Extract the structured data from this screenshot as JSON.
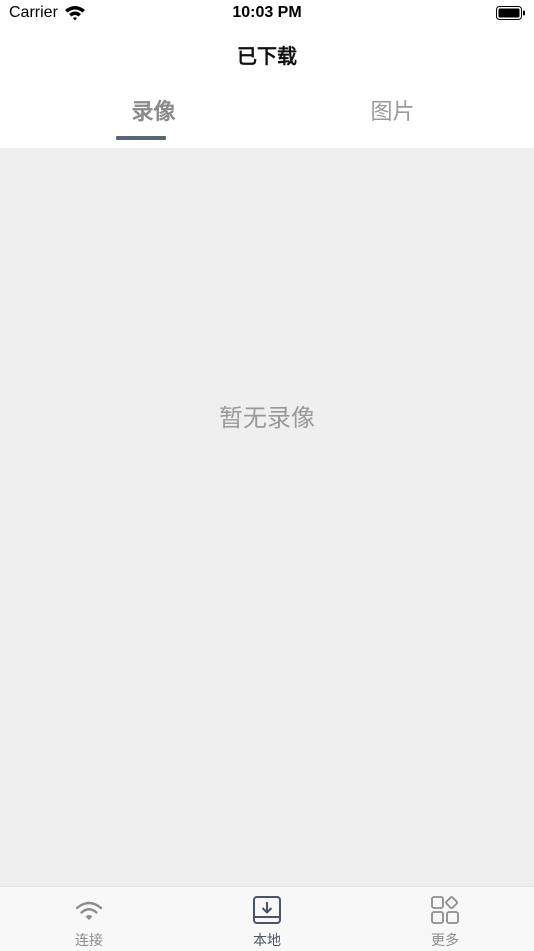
{
  "status_bar": {
    "carrier": "Carrier",
    "time": "10:03 PM"
  },
  "nav": {
    "title": "已下载"
  },
  "tabs": [
    {
      "label": "录像",
      "active": true
    },
    {
      "label": "图片",
      "active": false
    }
  ],
  "content": {
    "empty_message": "暂无录像"
  },
  "tab_bar": {
    "items": [
      {
        "label": "连接",
        "icon": "wifi-icon",
        "active": false
      },
      {
        "label": "本地",
        "icon": "download-box-icon",
        "active": true
      },
      {
        "label": "更多",
        "icon": "grid-more-icon",
        "active": false
      }
    ]
  },
  "colors": {
    "accent_underline": "#5b6675",
    "content_bg": "#efefef",
    "inactive_text": "#9a9a9a"
  }
}
